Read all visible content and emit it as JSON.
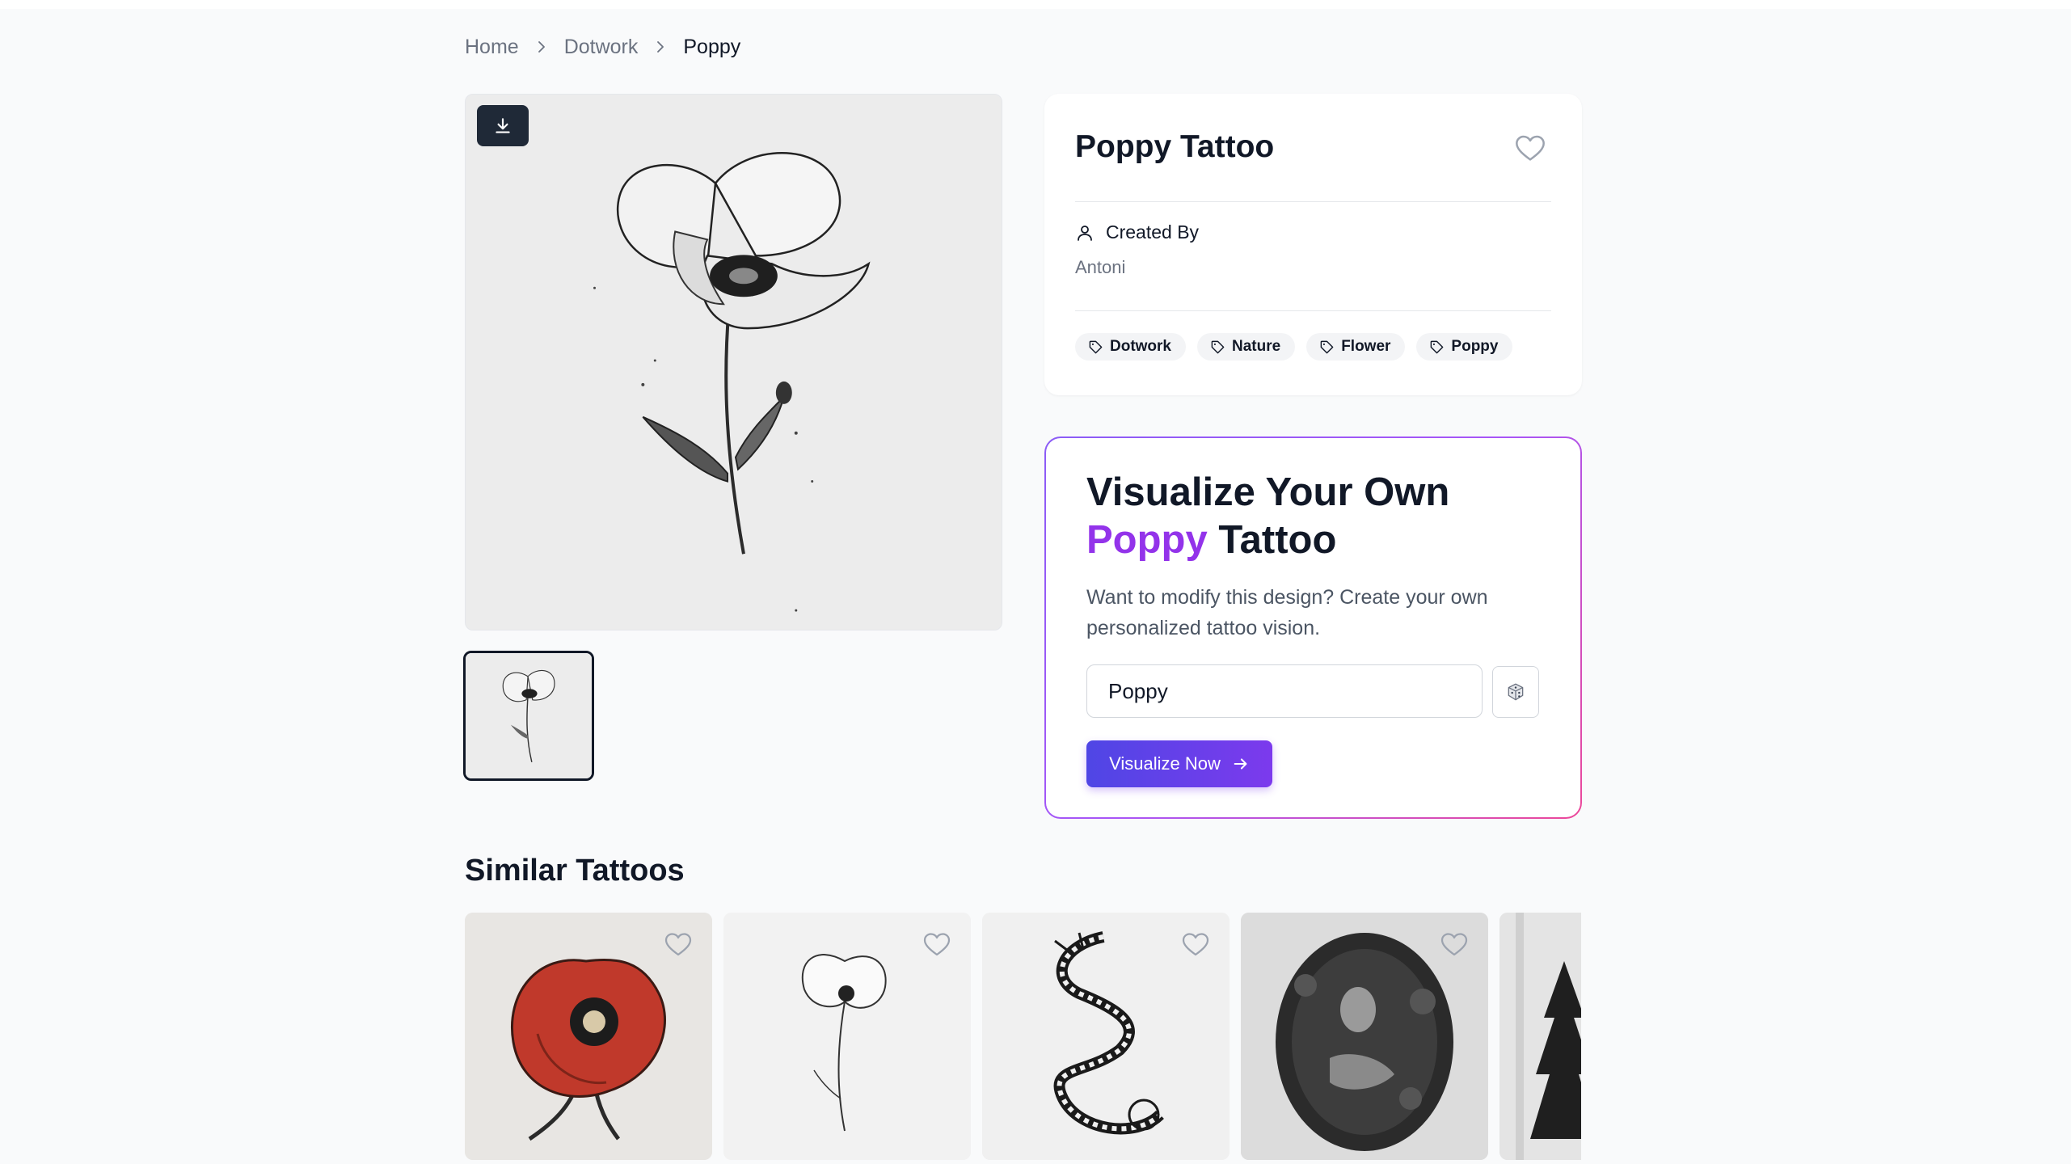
{
  "breadcrumb": {
    "items": [
      "Home",
      "Dotwork",
      "Poppy"
    ]
  },
  "main": {
    "download_icon": "download-icon",
    "thumbnail_alt": "poppy-thumbnail"
  },
  "info": {
    "title": "Poppy Tattoo",
    "favorite_icon": "heart-icon",
    "created_by_label": "Created By",
    "creator_name": "Antoni",
    "tags": [
      "Dotwork",
      "Nature",
      "Flower",
      "Poppy"
    ]
  },
  "visualize": {
    "title_line1": "Visualize Your Own",
    "title_accent": "Poppy",
    "title_rest": " Tattoo",
    "description": "Want to modify this design? Create your own personalized tattoo vision.",
    "input_value": "Poppy",
    "random_icon": "dice-icon",
    "button_label": "Visualize Now"
  },
  "similar": {
    "title": "Similar Tattoos",
    "items": [
      "red-poppy",
      "line-poppy",
      "dragon",
      "woman-foliage",
      "pine-forest"
    ]
  },
  "colors": {
    "accent_purple": "#9333ea",
    "button_start": "#4f46e5",
    "button_end": "#7c3aed",
    "border_pink": "#ec4899"
  }
}
